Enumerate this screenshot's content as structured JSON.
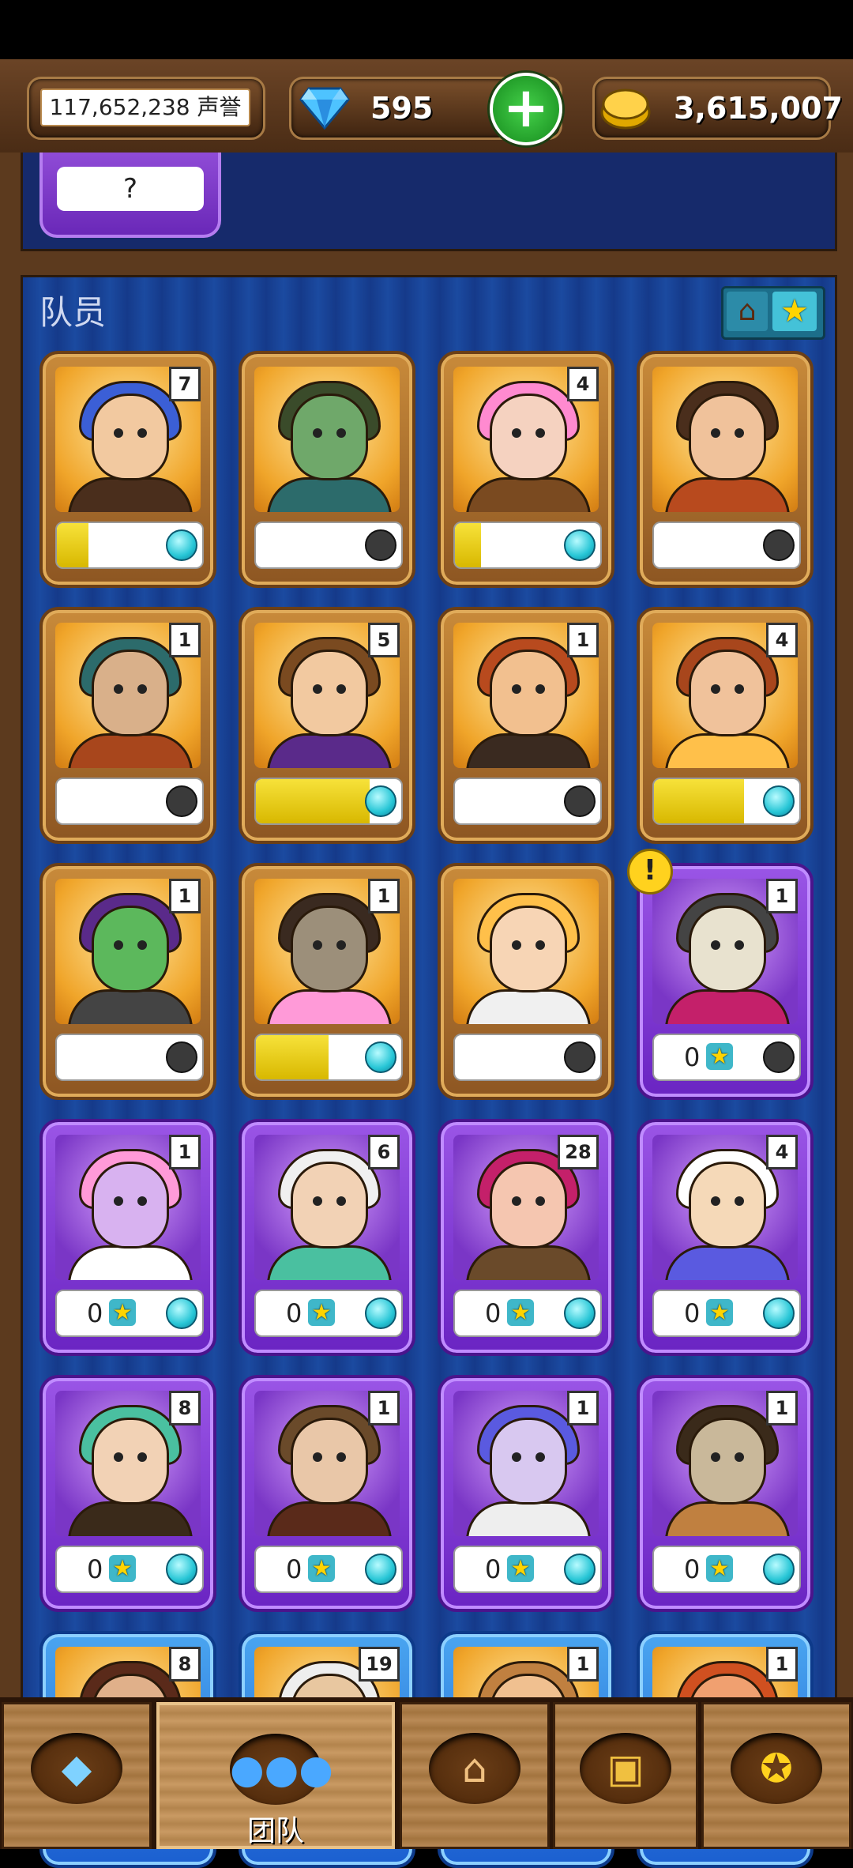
{
  "header": {
    "reputation": "117,652,238 声誉",
    "gems": "595",
    "gold": "3,615,007",
    "add_button_icon": "plus-icon"
  },
  "top_panel": {
    "unknown_card_label": "?"
  },
  "team": {
    "section_title": "队员",
    "sort_toggle_icons": [
      "home-icon",
      "star-icon"
    ],
    "star_count_text": "0",
    "members": [
      {
        "level": "7",
        "frame": "gold",
        "progress": 0.22,
        "gem": "on"
      },
      {
        "level": "",
        "frame": "gold",
        "progress": 0,
        "gem": "off"
      },
      {
        "level": "4",
        "frame": "gold",
        "progress": 0.18,
        "gem": "on"
      },
      {
        "level": "",
        "frame": "gold",
        "progress": 0,
        "gem": "off"
      },
      {
        "level": "1",
        "frame": "gold",
        "progress": 0,
        "gem": "off"
      },
      {
        "level": "5",
        "frame": "gold",
        "progress": 0.78,
        "gem": "on"
      },
      {
        "level": "1",
        "frame": "gold",
        "progress": 0,
        "gem": "off"
      },
      {
        "level": "4",
        "frame": "gold",
        "progress": 0.62,
        "gem": "on"
      },
      {
        "level": "1",
        "frame": "gold",
        "progress": 0,
        "gem": "off"
      },
      {
        "level": "1",
        "frame": "gold",
        "progress": 0.5,
        "gem": "on"
      },
      {
        "level": "",
        "frame": "gold",
        "progress": 0,
        "gem": "off"
      },
      {
        "level": "1",
        "frame": "purple",
        "stars": "0",
        "gem": "off",
        "alert": "!"
      },
      {
        "level": "1",
        "frame": "purple",
        "stars": "0",
        "gem": "on"
      },
      {
        "level": "6",
        "frame": "purple",
        "stars": "0",
        "gem": "on"
      },
      {
        "level": "28",
        "frame": "purple",
        "stars": "0",
        "gem": "on"
      },
      {
        "level": "4",
        "frame": "purple",
        "stars": "0",
        "gem": "on"
      },
      {
        "level": "8",
        "frame": "purple",
        "stars": "0",
        "gem": "on"
      },
      {
        "level": "1",
        "frame": "purple",
        "stars": "0",
        "gem": "on"
      },
      {
        "level": "1",
        "frame": "purple",
        "stars": "0",
        "gem": "on"
      },
      {
        "level": "1",
        "frame": "purple",
        "stars": "0",
        "gem": "on"
      },
      {
        "level": "8",
        "frame": "blue"
      },
      {
        "level": "19",
        "frame": "blue"
      },
      {
        "level": "1",
        "frame": "blue"
      },
      {
        "level": "1",
        "frame": "blue"
      }
    ]
  },
  "bottom_nav": {
    "items": [
      {
        "icon": "gem-icon",
        "label": ""
      },
      {
        "icon": "team-icon",
        "label": "团队",
        "active": true
      },
      {
        "icon": "house-icon",
        "label": ""
      },
      {
        "icon": "chest-icon",
        "label": ""
      },
      {
        "icon": "medal-icon",
        "label": ""
      }
    ]
  },
  "colors": {
    "wood": "#5c3a1e",
    "panel_blue": "#153a8a",
    "gold_frame": "#c88a3a",
    "purple_frame": "#9a55e6",
    "progress_yellow": "#f7e23a",
    "gem_cyan": "#27c6d6"
  }
}
